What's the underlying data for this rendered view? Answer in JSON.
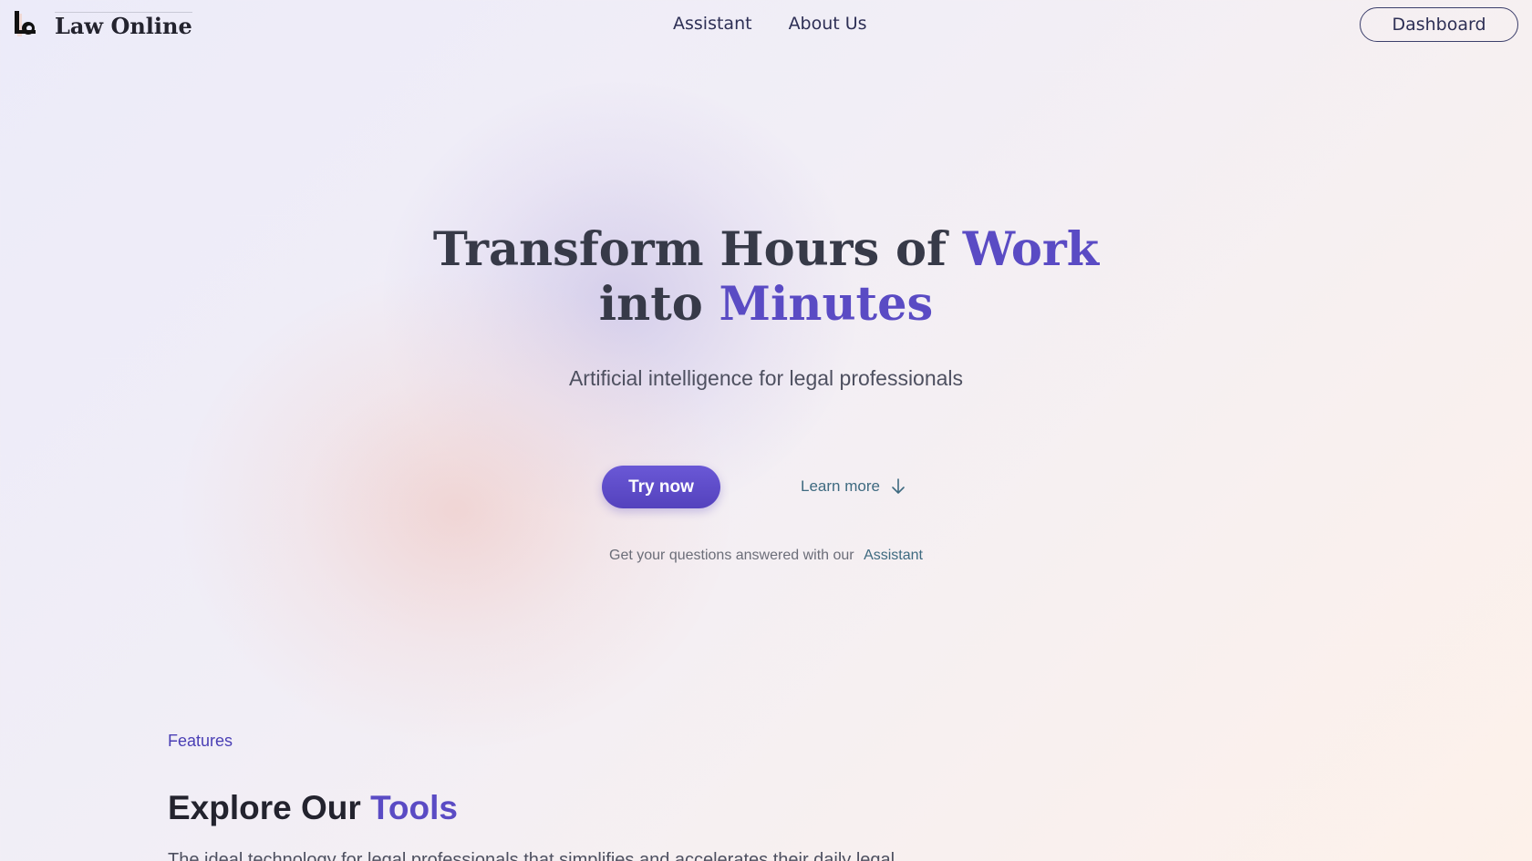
{
  "header": {
    "brand": "Law Online",
    "nav": [
      {
        "label": "Assistant"
      },
      {
        "label": "About Us"
      }
    ],
    "dashboard_label": "Dashboard"
  },
  "hero": {
    "title_line1_prefix": "Transform Hours of ",
    "title_line1_accent": "Work",
    "title_line2_prefix": "into ",
    "title_line2_accent": "Minutes",
    "subtitle": "Artificial intelligence for legal professionals",
    "try_now_label": "Try now",
    "learn_more_label": "Learn more",
    "assistant_prompt": "Get your questions answered with our",
    "assistant_link": "Assistant"
  },
  "features": {
    "label": "Features",
    "title_prefix": "Explore Our ",
    "title_accent": "Tools",
    "description": "The ideal technology for legal professionals that simplifies and accelerates their daily legal"
  },
  "colors": {
    "accent": "#5a4bc4",
    "button": "#5c4ac8",
    "link": "#3e6a80"
  }
}
